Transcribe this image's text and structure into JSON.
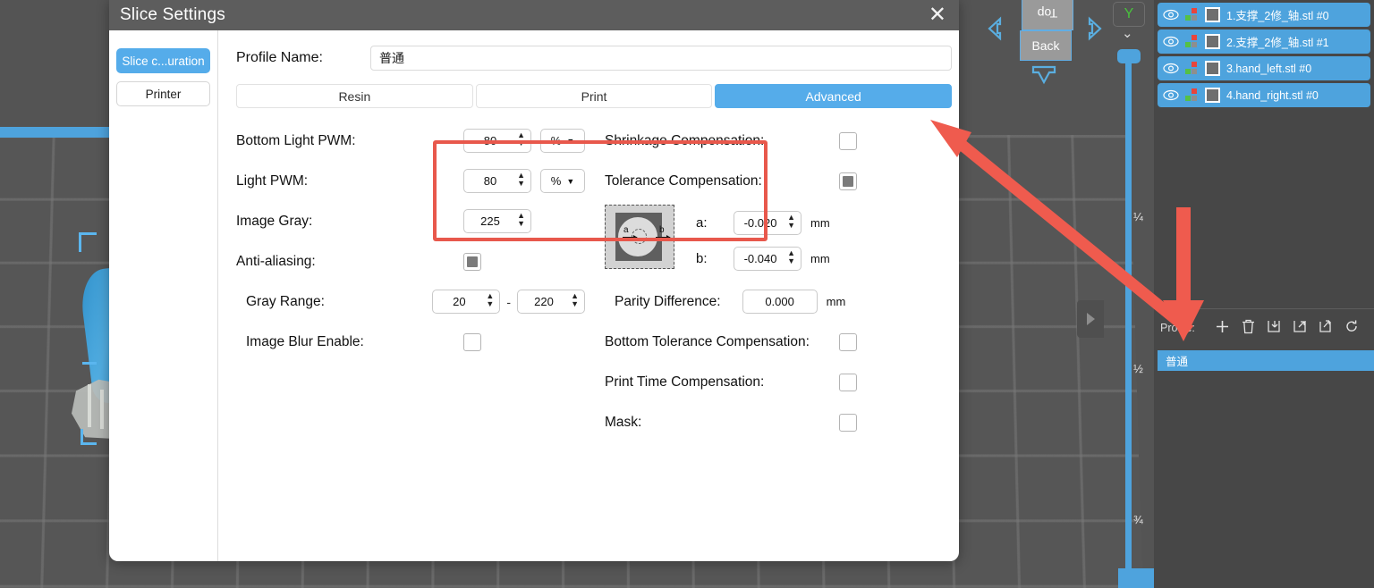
{
  "dialog": {
    "title": "Slice Settings",
    "close_icon": "close-icon",
    "side_nav": [
      {
        "label": "Slice c...uration",
        "active": true
      },
      {
        "label": "Printer",
        "active": false
      }
    ],
    "profile": {
      "label": "Profile Name:",
      "value": "普通",
      "placeholder": ""
    },
    "tabs": [
      {
        "label": "Resin",
        "active": false
      },
      {
        "label": "Print",
        "active": false
      },
      {
        "label": "Advanced",
        "active": true
      }
    ],
    "left_column": [
      {
        "name": "bottom-light-pwm",
        "label": "Bottom Light PWM:",
        "value": "80",
        "unit": "%",
        "focused": true
      },
      {
        "name": "light-pwm",
        "label": "Light PWM:",
        "value": "80",
        "unit": "%",
        "focused": false
      },
      {
        "name": "image-gray",
        "label": "Image Gray:",
        "value": "225"
      },
      {
        "name": "anti-aliasing",
        "label": "Anti-aliasing:",
        "checked": true
      },
      {
        "name": "gray-range",
        "label": "Gray Range:",
        "min": "20",
        "max": "220",
        "separator": "-"
      },
      {
        "name": "image-blur-enable",
        "label": "Image Blur Enable:",
        "checked": false
      }
    ],
    "right_column": {
      "shrinkage_compensation": {
        "label": "Shrinkage Compensation:",
        "checked": false
      },
      "tolerance_compensation": {
        "label": "Tolerance Compensation:",
        "checked": true
      },
      "diagram": {
        "a_label": "a",
        "b_label": "b"
      },
      "a": {
        "label": "a:",
        "value": "-0.020",
        "unit": "mm"
      },
      "b": {
        "label": "b:",
        "value": "-0.040",
        "unit": "mm"
      },
      "parity_difference": {
        "label": "Parity Difference:",
        "value": "0.000",
        "unit": "mm"
      },
      "bottom_tolerance_compensation": {
        "label": "Bottom Tolerance Compensation:",
        "checked": false
      },
      "print_time_compensation": {
        "label": "Print Time Compensation:",
        "checked": false
      },
      "mask": {
        "label": "Mask:",
        "checked": false
      }
    }
  },
  "viewport": {
    "nav_cube": {
      "top_face": "Top",
      "back_face": "Back",
      "left_arrow_icon": "arrow-left-icon",
      "right_arrow_icon": "arrow-right-icon",
      "down_arrow_icon": "arrow-down-icon"
    },
    "axis_badge": "Y",
    "chevron_icon": "chevron-down-icon",
    "slider_ticks": [
      "¼",
      "½",
      "¾"
    ],
    "collapse_icon": "triangle-right-icon"
  },
  "right_panel": {
    "objects": [
      {
        "label": "1.支撑_2修_轴.stl #0",
        "visible_icon": "eye-icon"
      },
      {
        "label": "2.支撑_2修_轴.stl #1",
        "visible_icon": "eye-icon"
      },
      {
        "label": "3.hand_left.stl #0",
        "visible_icon": "eye-icon"
      },
      {
        "label": "4.hand_right.stl #0",
        "visible_icon": "eye-icon"
      }
    ],
    "profile_section": {
      "label": "Profile:",
      "tools": [
        {
          "name": "add-profile-button",
          "glyph": "＋"
        },
        {
          "name": "delete-profile-button",
          "glyph": "🗑"
        },
        {
          "name": "import-profile-button",
          "glyph": "⤓"
        },
        {
          "name": "export-profile-button",
          "glyph": "↗"
        },
        {
          "name": "copy-profile-button",
          "glyph": "❐"
        },
        {
          "name": "refresh-profile-button",
          "glyph": "↻"
        }
      ],
      "items": [
        {
          "label": "普通",
          "selected": true
        }
      ]
    }
  },
  "annotations": {
    "highlight_color": "#e8584c",
    "arrow_color": "#ef5b4e",
    "arrows": [
      {
        "name": "arrow-to-advanced-tab",
        "direction": "up-left"
      },
      {
        "name": "arrow-to-profile-item",
        "direction": "down"
      }
    ]
  },
  "colors": {
    "accent_blue": "#4ea3dd",
    "tab_active": "#55acea",
    "panel_bg": "#474747",
    "titlebar": "#5d5d5d"
  }
}
